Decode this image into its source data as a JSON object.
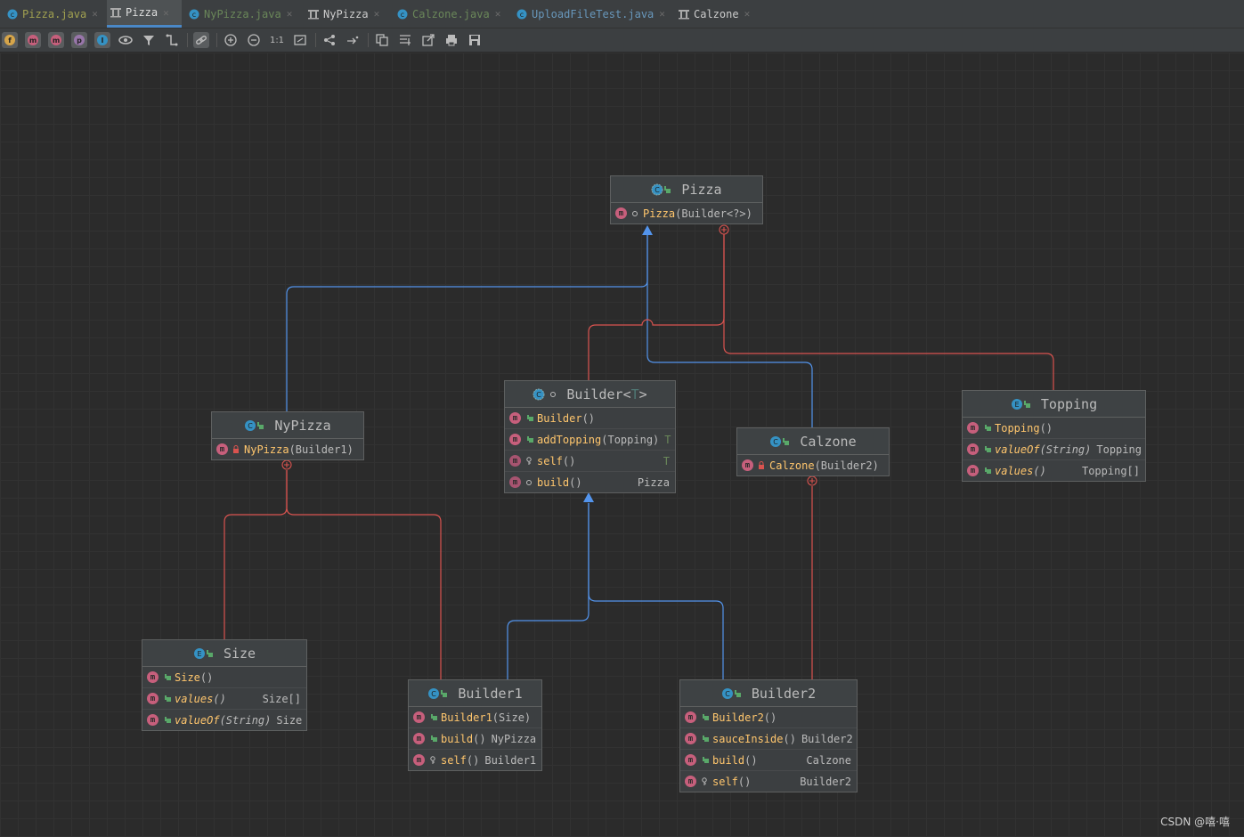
{
  "tabs": [
    {
      "label": "Pizza.java",
      "icon": "class-icon",
      "active": false
    },
    {
      "label": "Pizza",
      "icon": "diagram-icon",
      "active": true
    },
    {
      "label": "NyPizza.java",
      "icon": "class-icon",
      "active": false
    },
    {
      "label": "NyPizza",
      "icon": "diagram-icon",
      "active": false
    },
    {
      "label": "Calzone.java",
      "icon": "class-icon",
      "active": false
    },
    {
      "label": "UploadFileTest.java",
      "icon": "class-icon",
      "active": false
    },
    {
      "label": "Calzone",
      "icon": "diagram-icon",
      "active": false
    }
  ],
  "toolbar": {
    "buttons": [
      "f",
      "m",
      "m",
      "p",
      "I"
    ],
    "one_to_one": "1:1"
  },
  "nodes": {
    "pizza": {
      "title": "Pizza",
      "members": [
        {
          "name": "Pizza",
          "params": "(Builder<?>)",
          "ret": ""
        }
      ]
    },
    "nypizza": {
      "title": "NyPizza",
      "members": [
        {
          "name": "NyPizza",
          "params": "(Builder1)",
          "ret": ""
        }
      ]
    },
    "builder": {
      "title": "Builder",
      "title_lt": "<",
      "title_tv": "T",
      "title_gt": ">",
      "members": [
        {
          "name": "Builder",
          "params": "()",
          "ret": ""
        },
        {
          "name": "addTopping",
          "params": "(Topping)",
          "ret": "T"
        },
        {
          "name": "self",
          "params": "()",
          "ret": "T"
        },
        {
          "name": "build",
          "params": "()",
          "ret": "Pizza"
        }
      ]
    },
    "calzone": {
      "title": "Calzone",
      "members": [
        {
          "name": "Calzone",
          "params": "(Builder2)",
          "ret": ""
        }
      ]
    },
    "topping": {
      "title": "Topping",
      "members": [
        {
          "name": "Topping",
          "params": "()",
          "ret": ""
        },
        {
          "name": "valueOf",
          "params": "(String)",
          "ret": "Topping"
        },
        {
          "name": "values",
          "params": "()",
          "ret": "Topping[]"
        }
      ]
    },
    "size": {
      "title": "Size",
      "members": [
        {
          "name": "Size",
          "params": "()",
          "ret": ""
        },
        {
          "name": "values",
          "params": "()",
          "ret": "Size[]"
        },
        {
          "name": "valueOf",
          "params": "(String)",
          "ret": "Size"
        }
      ]
    },
    "builder1": {
      "title": "Builder1",
      "members": [
        {
          "name": "Builder1",
          "params": "(Size)",
          "ret": ""
        },
        {
          "name": "build",
          "params": "()",
          "ret": "NyPizza"
        },
        {
          "name": "self",
          "params": "()",
          "ret": "Builder1"
        }
      ]
    },
    "builder2": {
      "title": "Builder2",
      "members": [
        {
          "name": "Builder2",
          "params": "()",
          "ret": ""
        },
        {
          "name": "sauceInside",
          "params": "()",
          "ret": "Builder2"
        },
        {
          "name": "build",
          "params": "()",
          "ret": "Calzone"
        },
        {
          "name": "self",
          "params": "()",
          "ret": "Builder2"
        }
      ]
    }
  },
  "colors": {
    "inheritance": "#5394ec",
    "inner": "#d9534f",
    "method_badge": "#c75f7c",
    "method_name": "#ffc66d"
  },
  "watermark": "CSDN @嘻·嘻"
}
